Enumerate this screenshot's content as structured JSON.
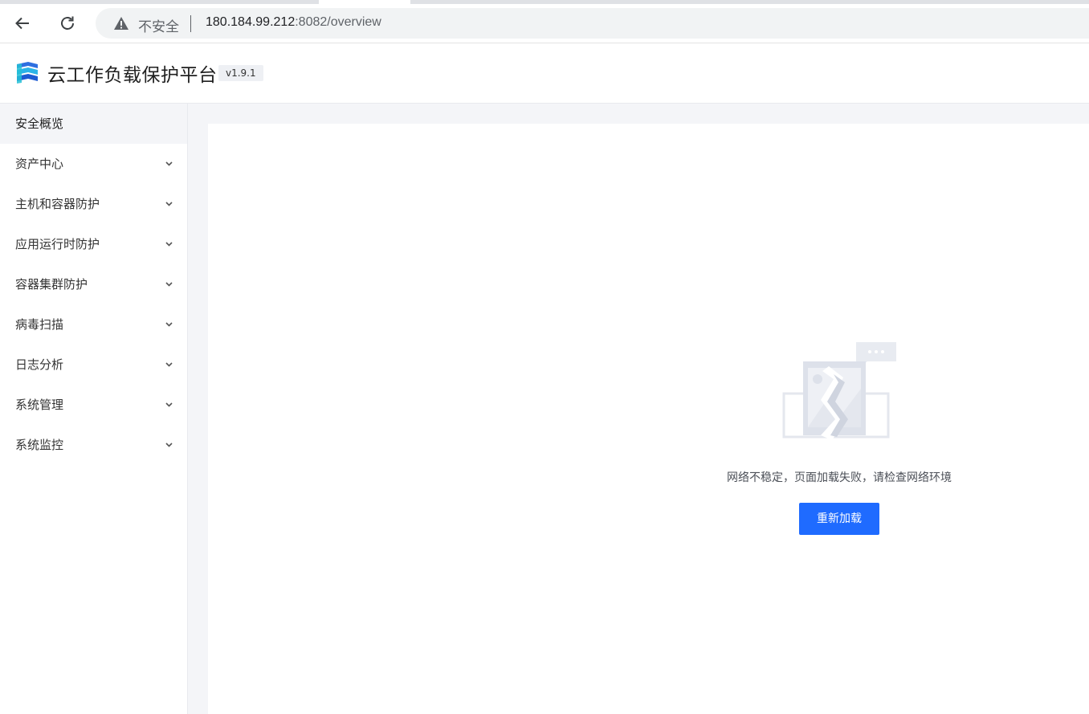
{
  "browser": {
    "security_label": "不安全",
    "url_host": "180.184.99.212",
    "url_rest": ":8082/overview"
  },
  "header": {
    "title": "云工作负载保护平台",
    "version": "v1.9.1"
  },
  "sidebar": {
    "items": [
      {
        "label": "安全概览",
        "active": true
      },
      {
        "label": "资产中心"
      },
      {
        "label": "主机和容器防护"
      },
      {
        "label": "应用运行时防护"
      },
      {
        "label": "容器集群防护"
      },
      {
        "label": "病毒扫描"
      },
      {
        "label": "日志分析"
      },
      {
        "label": "系统管理"
      },
      {
        "label": "系统监控"
      }
    ]
  },
  "main": {
    "error_message": "网络不稳定，页面加载失败，请检查网络环境",
    "reload_label": "重新加载"
  },
  "colors": {
    "accent": "#1f6bff",
    "sidebar_active_bg": "#f4f5f8",
    "content_bg": "#f4f5f8"
  },
  "icons": [
    "back-arrow-icon",
    "reload-icon",
    "warning-icon",
    "logo-icon",
    "chevron-down-icon",
    "network-error-illustration"
  ]
}
